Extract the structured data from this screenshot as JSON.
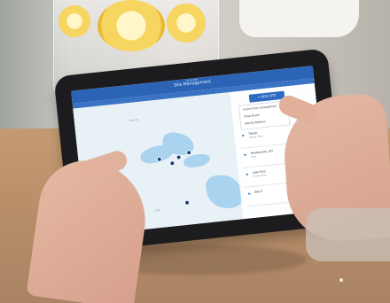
{
  "app": {
    "title": "Site Management",
    "status_time": "9:41 AM"
  },
  "toolbar": {
    "add_label": "+ ADD SITE"
  },
  "menu": {
    "items": [
      "Import from Spreadsheet",
      "Draw Route",
      "Add By Address"
    ]
  },
  "list": [
    {
      "title": "Toledo",
      "subtitle": "Toledo, Ohio",
      "icon": "site-icon"
    },
    {
      "title": "Brownsville, OH",
      "subtitle": "Ohio",
      "icon": "site-icon"
    },
    {
      "title": "Lake Erie",
      "subtitle": "Great Lakes",
      "icon": "site-icon"
    },
    {
      "title": "Site 5",
      "subtitle": "",
      "icon": "site-icon"
    }
  ],
  "map": {
    "labels": [
      "Ontario",
      "Michigan",
      "Ohio"
    ]
  },
  "colors": {
    "primary": "#2b63b5",
    "map_water": "#a9d3ee",
    "map_land": "#e7f1f6"
  }
}
